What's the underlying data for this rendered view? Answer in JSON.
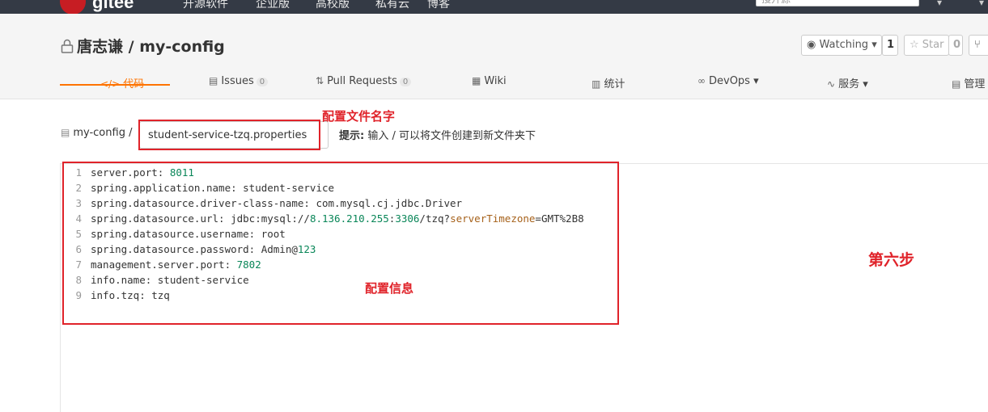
{
  "topnav": {
    "logo_text": "gitee",
    "links": [
      "开源软件",
      "企业版",
      "高校版",
      "私有云",
      "博客"
    ],
    "search_placeholder": "搜开源"
  },
  "project": {
    "owner": "唐志谦",
    "separator": " / ",
    "name": "my-config",
    "watch_label": "Watching ▾",
    "watch_count": "1",
    "star_label": "☆ Star",
    "star_count": "0"
  },
  "tabs": [
    {
      "icon": "</>",
      "label": "代码"
    },
    {
      "icon": "▤",
      "label": "Issues",
      "badge": "0"
    },
    {
      "icon": "⇅",
      "label": "Pull Requests",
      "badge": "0"
    },
    {
      "icon": "▦",
      "label": "Wiki"
    },
    {
      "icon": "▥",
      "label": "统计"
    },
    {
      "icon": "∞",
      "label": "DevOps ▾"
    },
    {
      "icon": "∿",
      "label": "服务 ▾"
    },
    {
      "icon": "▤",
      "label": "管理"
    }
  ],
  "editor": {
    "crumb_root": "my-config",
    "crumb_sep": " /",
    "filename_value": "student-service-tzq.properties",
    "hint_label": "提示:",
    "hint_text": " 输入 / 可以将文件创建到新文件夹下",
    "lines": [
      {
        "n": "1",
        "text": "server.port: ",
        "val": "8011"
      },
      {
        "n": "2",
        "text": "spring.application.name: student-service"
      },
      {
        "n": "3",
        "text": "spring.datasource.driver-class-name: com.mysql.cj.jdbc.Driver"
      },
      {
        "n": "4",
        "text": "spring.datasource.url: jdbc:mysql://8.136.210.255:3306/tzq?serverTimezone=GMT%2B8"
      },
      {
        "n": "5",
        "text": "spring.datasource.username: root"
      },
      {
        "n": "6",
        "text": "spring.datasource.password: Admin@123"
      },
      {
        "n": "7",
        "text": "management.server.port: ",
        "val": "7802"
      },
      {
        "n": "8",
        "text": "info.name: student-service"
      },
      {
        "n": "9",
        "text": "info.tzq: tzq"
      }
    ]
  },
  "annotations": {
    "filename_note": "配置文件名字",
    "config_note": "配置信息",
    "step_note": "第六步",
    "color": "#e0232a"
  }
}
